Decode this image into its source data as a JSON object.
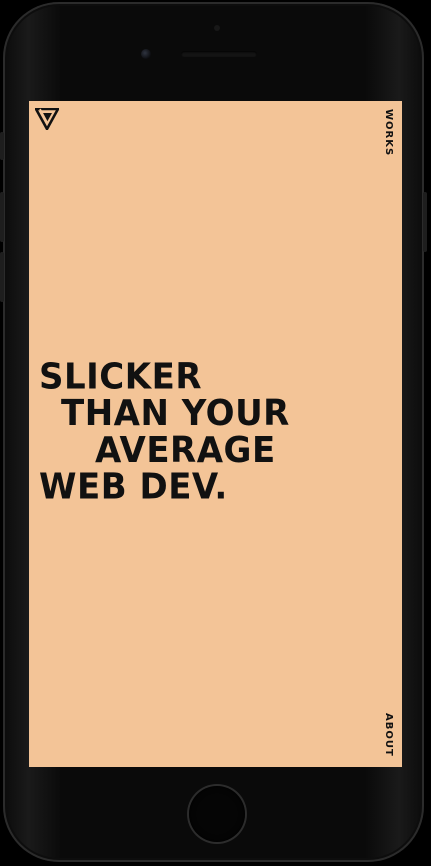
{
  "nav": {
    "works_label": "WORKS",
    "about_label": "ABOUT"
  },
  "logo": {
    "icon": "triangle-v-logo-icon"
  },
  "hero": {
    "line1": "SLICKER",
    "line2": "THAN YOUR",
    "line3": "AVERAGE",
    "line4": "WEB DEV."
  },
  "colors": {
    "screen_background": "#f3c497",
    "text": "#111111",
    "device_frame": "#0a0a0a"
  }
}
